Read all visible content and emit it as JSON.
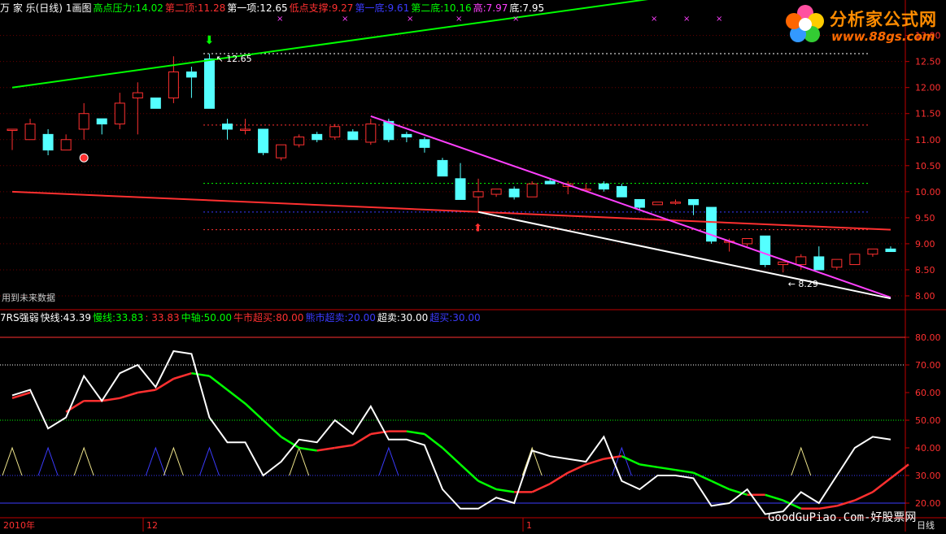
{
  "header": {
    "items": [
      {
        "label": "万 家 乐(日线) 1画图",
        "value": "",
        "color": "#ffffff"
      },
      {
        "label": "高点压力:",
        "value": "14.02",
        "color": "#00ff00"
      },
      {
        "label": "第二顶:",
        "value": "11.28",
        "color": "#ff3030"
      },
      {
        "label": "第一项:",
        "value": "12.65",
        "color": "#ffffff"
      },
      {
        "label": "低点支撑:",
        "value": "9.27",
        "color": "#ff3030"
      },
      {
        "label": "第一底:",
        "value": "9.61",
        "color": "#3b3bff"
      },
      {
        "label": "第二底:",
        "value": "10.16",
        "color": "#00ff00"
      },
      {
        "label": "高:",
        "value": "7.97",
        "color": "#ff40ff"
      },
      {
        "label": "底:",
        "value": "7.95",
        "color": "#ffffff"
      }
    ]
  },
  "indicator_header": {
    "items": [
      {
        "label": "7RS强弱",
        "value": "",
        "color": "#ffffff"
      },
      {
        "label": "快线:",
        "value": "43.39",
        "color": "#ffffff"
      },
      {
        "label": "慢线:",
        "value": "33.83",
        "color": "#00ff00"
      },
      {
        "label": "",
        "value": ": 33.83",
        "color": "#ff3030"
      },
      {
        "label": "中轴:",
        "value": "50.00",
        "color": "#00ff00"
      },
      {
        "label": "牛市超买:",
        "value": "80.00",
        "color": "#ff3030"
      },
      {
        "label": "熊市超卖:",
        "value": "20.00",
        "color": "#3b3bff"
      },
      {
        "label": "超卖:",
        "value": "30.00",
        "color": "#ffffff"
      },
      {
        "label": "超买:",
        "value": "30.00",
        "color": "#3b3bff"
      }
    ]
  },
  "logo": {
    "title": "分析家公式网",
    "url": "www.88gs.com"
  },
  "note": "用到未来数据",
  "watermark": "GoodGuPiao.Com-好股票网",
  "period": "日线",
  "annotations": {
    "high": "12.65",
    "low": "8.29"
  },
  "colors": {
    "up": "#ff3030",
    "down": "#54ffff",
    "green": "#00ff00",
    "magenta": "#ff40ff",
    "blue": "#3b3bff",
    "axis": "#c00000"
  },
  "chart_data": [
    {
      "type": "candlestick",
      "title": "万 家 乐(日线)",
      "ylim": [
        7.75,
        13.4
      ],
      "y_ticks": [
        "8.00",
        "8.50",
        "9.00",
        "9.50",
        "10.00",
        "10.50",
        "11.00",
        "11.50",
        "12.00",
        "12.50",
        "13.00"
      ],
      "x_labels": [
        "2010年",
        "12",
        "1"
      ],
      "candles": [
        {
          "o": 11.2,
          "h": 11.2,
          "l": 10.8,
          "c": 11.2
        },
        {
          "o": 11.0,
          "h": 11.4,
          "l": 11.0,
          "c": 11.3
        },
        {
          "o": 11.1,
          "h": 11.2,
          "l": 10.7,
          "c": 10.8
        },
        {
          "o": 10.8,
          "h": 11.1,
          "l": 10.8,
          "c": 11.0
        },
        {
          "o": 11.2,
          "h": 11.7,
          "l": 11.0,
          "c": 11.5
        },
        {
          "o": 11.4,
          "h": 11.4,
          "l": 11.1,
          "c": 11.3
        },
        {
          "o": 11.3,
          "h": 11.9,
          "l": 11.2,
          "c": 11.7
        },
        {
          "o": 11.8,
          "h": 12.1,
          "l": 11.1,
          "c": 11.9
        },
        {
          "o": 11.8,
          "h": 11.8,
          "l": 11.6,
          "c": 11.6
        },
        {
          "o": 11.8,
          "h": 12.6,
          "l": 11.7,
          "c": 12.3
        },
        {
          "o": 12.3,
          "h": 12.4,
          "l": 11.8,
          "c": 12.2
        },
        {
          "o": 12.55,
          "h": 12.65,
          "l": 11.6,
          "c": 11.6
        },
        {
          "o": 11.3,
          "h": 11.4,
          "l": 11.0,
          "c": 11.2
        },
        {
          "o": 11.2,
          "h": 11.4,
          "l": 11.1,
          "c": 11.2
        },
        {
          "o": 11.2,
          "h": 11.2,
          "l": 10.7,
          "c": 10.75
        },
        {
          "o": 10.65,
          "h": 10.9,
          "l": 10.6,
          "c": 10.9
        },
        {
          "o": 10.9,
          "h": 11.1,
          "l": 10.85,
          "c": 11.05
        },
        {
          "o": 11.1,
          "h": 11.15,
          "l": 10.95,
          "c": 11.0
        },
        {
          "o": 11.05,
          "h": 11.3,
          "l": 11.0,
          "c": 11.25
        },
        {
          "o": 11.15,
          "h": 11.2,
          "l": 11.0,
          "c": 11.0
        },
        {
          "o": 10.95,
          "h": 11.4,
          "l": 10.9,
          "c": 11.3
        },
        {
          "o": 11.35,
          "h": 11.4,
          "l": 10.95,
          "c": 11.0
        },
        {
          "o": 11.1,
          "h": 11.15,
          "l": 10.95,
          "c": 11.05
        },
        {
          "o": 11.0,
          "h": 11.05,
          "l": 10.75,
          "c": 10.85
        },
        {
          "o": 10.6,
          "h": 10.65,
          "l": 10.3,
          "c": 10.3
        },
        {
          "o": 10.25,
          "h": 10.55,
          "l": 9.85,
          "c": 9.85
        },
        {
          "o": 9.9,
          "h": 10.25,
          "l": 9.6,
          "c": 10.0
        },
        {
          "o": 9.95,
          "h": 10.05,
          "l": 9.9,
          "c": 10.05
        },
        {
          "o": 10.05,
          "h": 10.1,
          "l": 9.85,
          "c": 9.9
        },
        {
          "o": 9.9,
          "h": 10.2,
          "l": 9.9,
          "c": 10.15
        },
        {
          "o": 10.2,
          "h": 10.25,
          "l": 10.15,
          "c": 10.15
        },
        {
          "o": 10.1,
          "h": 10.2,
          "l": 9.95,
          "c": 10.15
        },
        {
          "o": 10.05,
          "h": 10.15,
          "l": 10.0,
          "c": 10.05
        },
        {
          "o": 10.15,
          "h": 10.2,
          "l": 10.0,
          "c": 10.05
        },
        {
          "o": 10.1,
          "h": 10.15,
          "l": 9.9,
          "c": 9.9
        },
        {
          "o": 9.85,
          "h": 9.85,
          "l": 9.65,
          "c": 9.7
        },
        {
          "o": 9.75,
          "h": 9.8,
          "l": 9.75,
          "c": 9.8
        },
        {
          "o": 9.8,
          "h": 9.85,
          "l": 9.75,
          "c": 9.8
        },
        {
          "o": 9.85,
          "h": 9.85,
          "l": 9.55,
          "c": 9.75
        },
        {
          "o": 9.7,
          "h": 9.7,
          "l": 9.0,
          "c": 9.05
        },
        {
          "o": 9.05,
          "h": 9.1,
          "l": 8.85,
          "c": 9.05
        },
        {
          "o": 9.0,
          "h": 9.1,
          "l": 8.95,
          "c": 9.1
        },
        {
          "o": 9.15,
          "h": 9.15,
          "l": 8.55,
          "c": 8.6
        },
        {
          "o": 8.6,
          "h": 8.65,
          "l": 8.45,
          "c": 8.65
        },
        {
          "o": 8.6,
          "h": 8.8,
          "l": 8.5,
          "c": 8.75
        },
        {
          "o": 8.75,
          "h": 8.95,
          "l": 8.5,
          "c": 8.5
        },
        {
          "o": 8.55,
          "h": 8.7,
          "l": 8.5,
          "c": 8.7
        },
        {
          "o": 8.6,
          "h": 8.8,
          "l": 8.6,
          "c": 8.8
        },
        {
          "o": 8.8,
          "h": 8.9,
          "l": 8.75,
          "c": 8.9
        },
        {
          "o": 8.9,
          "h": 8.95,
          "l": 8.85,
          "c": 8.85
        }
      ],
      "levels": [
        {
          "value": 12.65,
          "color": "#ffffff"
        },
        {
          "value": 11.28,
          "color": "#ff3030"
        },
        {
          "value": 10.16,
          "color": "#00ff00"
        },
        {
          "value": 9.61,
          "color": "#3b3bff"
        },
        {
          "value": 9.27,
          "color": "#ff3030"
        }
      ],
      "trendlines": [
        {
          "color": "#00ff00",
          "from": [
            0,
            12.0
          ],
          "to": [
            46,
            14.2
          ]
        },
        {
          "color": "#ff3030",
          "from": [
            0,
            10.0
          ],
          "to": [
            49,
            9.27
          ]
        },
        {
          "color": "#ff40ff",
          "from": [
            20,
            11.45
          ],
          "to": [
            49,
            7.97
          ]
        },
        {
          "color": "#ffffff",
          "from": [
            26,
            9.61
          ],
          "to": [
            49,
            7.95
          ]
        }
      ]
    },
    {
      "type": "line",
      "title": "7RS强弱",
      "ylim": [
        15,
        85
      ],
      "y_ticks": [
        "20.00",
        "30.00",
        "40.00",
        "50.00",
        "60.00",
        "70.00",
        "80.00"
      ],
      "ref_lines": [
        {
          "value": 80,
          "color": "#ff3030"
        },
        {
          "value": 70,
          "color": "#ffffff"
        },
        {
          "value": 50,
          "color": "#00ff00"
        },
        {
          "value": 30,
          "color": "#3b3bff"
        },
        {
          "value": 20,
          "color": "#3b3bff"
        }
      ],
      "series": [
        {
          "name": "快线",
          "color": "#ffffff",
          "values": [
            59,
            61,
            47,
            51,
            66,
            57,
            67,
            70,
            62,
            75,
            74,
            51,
            42,
            42,
            30,
            35,
            43,
            42,
            50,
            45,
            55,
            43,
            43,
            41,
            25,
            18,
            18,
            22,
            20,
            39,
            37,
            36,
            35,
            44,
            28,
            25,
            30,
            30,
            29,
            19,
            20,
            25,
            16,
            17,
            24,
            20,
            30,
            40,
            44,
            43
          ]
        },
        {
          "name": "慢线",
          "color": "#00ff00",
          "values": [
            58,
            60,
            null,
            53,
            57,
            57,
            58,
            60,
            61,
            65,
            67,
            66,
            61,
            56,
            50,
            44,
            40,
            39,
            40,
            41,
            45,
            46,
            46,
            45,
            40,
            34,
            28,
            25,
            24,
            24,
            27,
            31,
            34,
            36,
            37,
            34,
            33,
            32,
            31,
            28,
            25,
            23,
            23,
            21,
            18,
            18,
            19,
            21,
            24,
            29,
            34
          ]
        }
      ],
      "triangles": [
        {
          "x": [
            0,
            4
          ],
          "color": "#f0e68c"
        },
        {
          "x": [
            2
          ],
          "color": "#3b3bff"
        },
        {
          "x": [
            8,
            11
          ],
          "color": "#3b3bff"
        },
        {
          "x": [
            9,
            16
          ],
          "color": "#f0e68c"
        },
        {
          "x": [
            21
          ],
          "color": "#3b3bff"
        },
        {
          "x": [
            29,
            44
          ],
          "color": "#f0e68c"
        },
        {
          "x": [
            34
          ],
          "color": "#3b3bff"
        }
      ]
    }
  ]
}
